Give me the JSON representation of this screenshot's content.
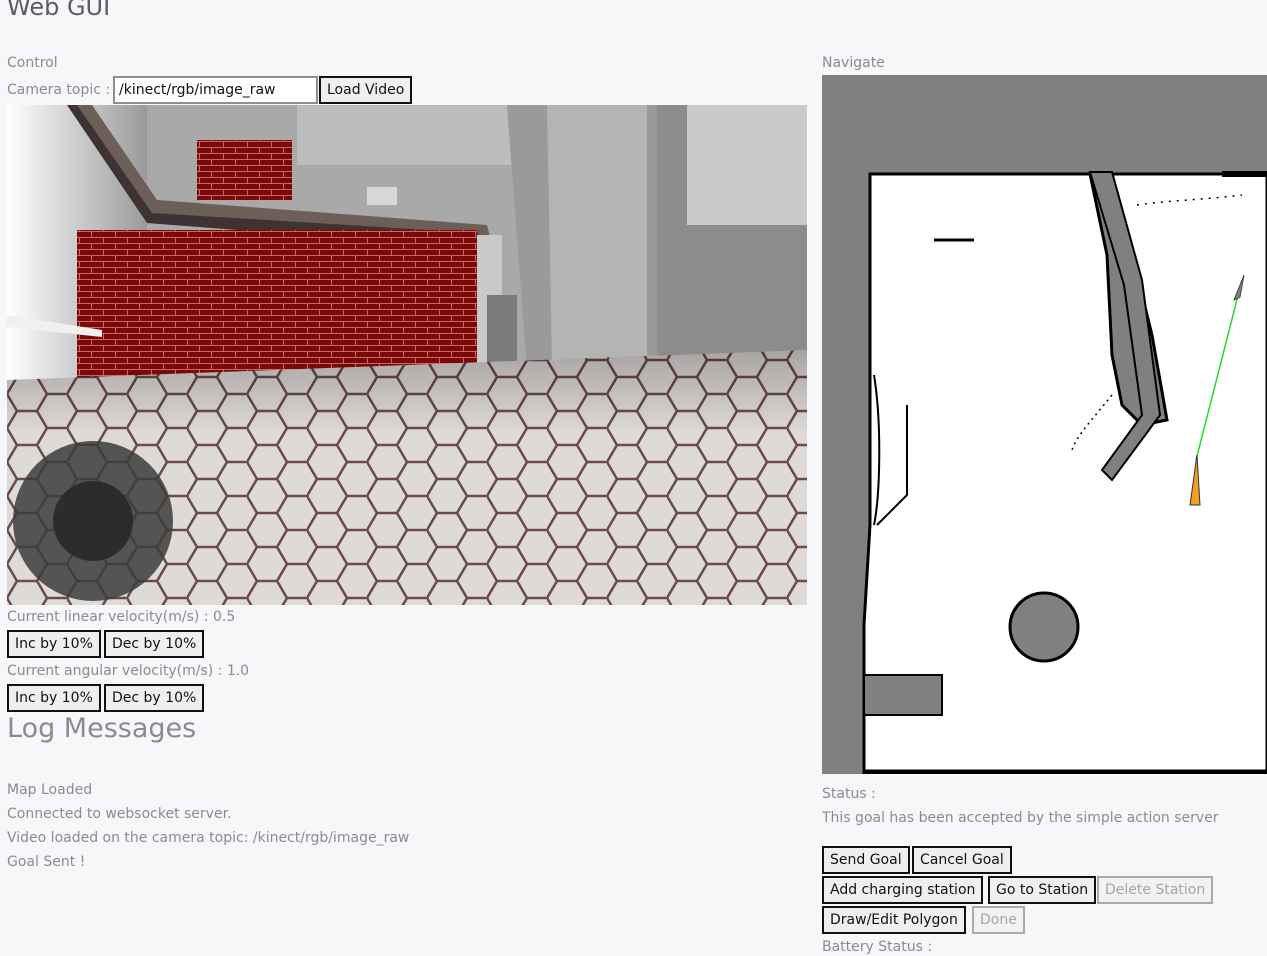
{
  "app": {
    "title": "Web GUI"
  },
  "control": {
    "heading": "Control",
    "camera_topic_label": "Camera topic :",
    "camera_topic_value": "/kinect/rgb/image_raw",
    "load_video_label": "Load Video",
    "linear_velocity_label": "Current linear velocity(m/s) : 0.5",
    "angular_velocity_label": "Current angular velocity(m/s) : 1.0",
    "inc_label": "Inc by 10%",
    "dec_label": "Dec by 10%"
  },
  "log": {
    "heading": "Log Messages",
    "messages": [
      "Map Loaded",
      "Connected to websocket server.",
      "Video loaded on the camera topic: /kinect/rgb/image_raw",
      "Goal Sent !"
    ]
  },
  "navigate": {
    "heading": "Navigate",
    "status_label": "Status :",
    "status_message": "This goal has been accepted by the simple action server",
    "buttons": {
      "send_goal": "Send Goal",
      "cancel_goal": "Cancel Goal",
      "add_station": "Add charging station",
      "go_to_station": "Go to Station",
      "delete_station": "Delete Station",
      "draw_polygon": "Draw/Edit Polygon",
      "done": "Done"
    },
    "battery_label": "Battery Status :"
  },
  "colors": {
    "accent_goal_line": "#22dd22",
    "robot_marker": "#f2a020",
    "brick": "#7a0a0a"
  }
}
